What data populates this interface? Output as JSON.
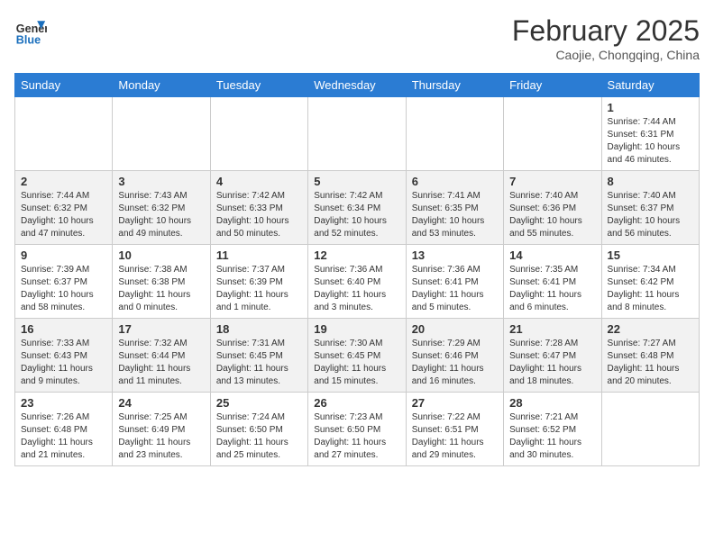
{
  "header": {
    "logo_line1": "General",
    "logo_line2": "Blue",
    "month_year": "February 2025",
    "location": "Caojie, Chongqing, China"
  },
  "days_of_week": [
    "Sunday",
    "Monday",
    "Tuesday",
    "Wednesday",
    "Thursday",
    "Friday",
    "Saturday"
  ],
  "weeks": [
    {
      "shaded": false,
      "days": [
        {
          "number": "",
          "info": ""
        },
        {
          "number": "",
          "info": ""
        },
        {
          "number": "",
          "info": ""
        },
        {
          "number": "",
          "info": ""
        },
        {
          "number": "",
          "info": ""
        },
        {
          "number": "",
          "info": ""
        },
        {
          "number": "1",
          "info": "Sunrise: 7:44 AM\nSunset: 6:31 PM\nDaylight: 10 hours and 46 minutes."
        }
      ]
    },
    {
      "shaded": true,
      "days": [
        {
          "number": "2",
          "info": "Sunrise: 7:44 AM\nSunset: 6:32 PM\nDaylight: 10 hours and 47 minutes."
        },
        {
          "number": "3",
          "info": "Sunrise: 7:43 AM\nSunset: 6:32 PM\nDaylight: 10 hours and 49 minutes."
        },
        {
          "number": "4",
          "info": "Sunrise: 7:42 AM\nSunset: 6:33 PM\nDaylight: 10 hours and 50 minutes."
        },
        {
          "number": "5",
          "info": "Sunrise: 7:42 AM\nSunset: 6:34 PM\nDaylight: 10 hours and 52 minutes."
        },
        {
          "number": "6",
          "info": "Sunrise: 7:41 AM\nSunset: 6:35 PM\nDaylight: 10 hours and 53 minutes."
        },
        {
          "number": "7",
          "info": "Sunrise: 7:40 AM\nSunset: 6:36 PM\nDaylight: 10 hours and 55 minutes."
        },
        {
          "number": "8",
          "info": "Sunrise: 7:40 AM\nSunset: 6:37 PM\nDaylight: 10 hours and 56 minutes."
        }
      ]
    },
    {
      "shaded": false,
      "days": [
        {
          "number": "9",
          "info": "Sunrise: 7:39 AM\nSunset: 6:37 PM\nDaylight: 10 hours and 58 minutes."
        },
        {
          "number": "10",
          "info": "Sunrise: 7:38 AM\nSunset: 6:38 PM\nDaylight: 11 hours and 0 minutes."
        },
        {
          "number": "11",
          "info": "Sunrise: 7:37 AM\nSunset: 6:39 PM\nDaylight: 11 hours and 1 minute."
        },
        {
          "number": "12",
          "info": "Sunrise: 7:36 AM\nSunset: 6:40 PM\nDaylight: 11 hours and 3 minutes."
        },
        {
          "number": "13",
          "info": "Sunrise: 7:36 AM\nSunset: 6:41 PM\nDaylight: 11 hours and 5 minutes."
        },
        {
          "number": "14",
          "info": "Sunrise: 7:35 AM\nSunset: 6:41 PM\nDaylight: 11 hours and 6 minutes."
        },
        {
          "number": "15",
          "info": "Sunrise: 7:34 AM\nSunset: 6:42 PM\nDaylight: 11 hours and 8 minutes."
        }
      ]
    },
    {
      "shaded": true,
      "days": [
        {
          "number": "16",
          "info": "Sunrise: 7:33 AM\nSunset: 6:43 PM\nDaylight: 11 hours and 9 minutes."
        },
        {
          "number": "17",
          "info": "Sunrise: 7:32 AM\nSunset: 6:44 PM\nDaylight: 11 hours and 11 minutes."
        },
        {
          "number": "18",
          "info": "Sunrise: 7:31 AM\nSunset: 6:45 PM\nDaylight: 11 hours and 13 minutes."
        },
        {
          "number": "19",
          "info": "Sunrise: 7:30 AM\nSunset: 6:45 PM\nDaylight: 11 hours and 15 minutes."
        },
        {
          "number": "20",
          "info": "Sunrise: 7:29 AM\nSunset: 6:46 PM\nDaylight: 11 hours and 16 minutes."
        },
        {
          "number": "21",
          "info": "Sunrise: 7:28 AM\nSunset: 6:47 PM\nDaylight: 11 hours and 18 minutes."
        },
        {
          "number": "22",
          "info": "Sunrise: 7:27 AM\nSunset: 6:48 PM\nDaylight: 11 hours and 20 minutes."
        }
      ]
    },
    {
      "shaded": false,
      "days": [
        {
          "number": "23",
          "info": "Sunrise: 7:26 AM\nSunset: 6:48 PM\nDaylight: 11 hours and 21 minutes."
        },
        {
          "number": "24",
          "info": "Sunrise: 7:25 AM\nSunset: 6:49 PM\nDaylight: 11 hours and 23 minutes."
        },
        {
          "number": "25",
          "info": "Sunrise: 7:24 AM\nSunset: 6:50 PM\nDaylight: 11 hours and 25 minutes."
        },
        {
          "number": "26",
          "info": "Sunrise: 7:23 AM\nSunset: 6:50 PM\nDaylight: 11 hours and 27 minutes."
        },
        {
          "number": "27",
          "info": "Sunrise: 7:22 AM\nSunset: 6:51 PM\nDaylight: 11 hours and 29 minutes."
        },
        {
          "number": "28",
          "info": "Sunrise: 7:21 AM\nSunset: 6:52 PM\nDaylight: 11 hours and 30 minutes."
        },
        {
          "number": "",
          "info": ""
        }
      ]
    }
  ]
}
